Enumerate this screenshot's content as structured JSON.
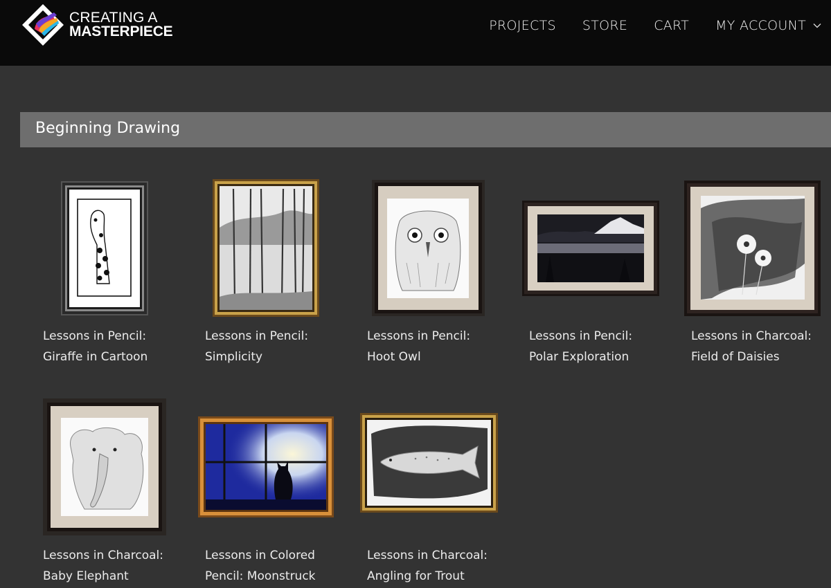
{
  "header": {
    "logo": {
      "line1": "CREATING A",
      "line2": "MASTERPIECE",
      "icon": "paint-diamond-logo-icon"
    },
    "nav": [
      {
        "label": "PROJECTS"
      },
      {
        "label": "STORE"
      },
      {
        "label": "CART"
      },
      {
        "label": "MY ACCOUNT",
        "icon": "chevron-down-icon"
      }
    ]
  },
  "section": {
    "title": "Beginning Drawing"
  },
  "projects": [
    {
      "line1": "Lessons in Pencil:",
      "line2": "Giraffe in Cartoon",
      "artwork": "giraffe-drawing"
    },
    {
      "line1": "Lessons in Pencil:",
      "line2": "Simplicity",
      "artwork": "forest-drawing"
    },
    {
      "line1": "Lessons in Pencil:",
      "line2": "Hoot Owl",
      "artwork": "owl-drawing"
    },
    {
      "line1": "Lessons in Pencil:",
      "line2": "Polar Exploration",
      "artwork": "mountain-lake-drawing"
    },
    {
      "line1": "Lessons in Charcoal:",
      "line2": "Field of Daisies",
      "artwork": "daisies-drawing"
    },
    {
      "line1": "Lessons in Charcoal:",
      "line2": "Baby Elephant",
      "artwork": "elephant-drawing"
    },
    {
      "line1": "Lessons in Colored",
      "line2": "Pencil: Moonstruck",
      "artwork": "cat-window-drawing"
    },
    {
      "line1": "Lessons in Charcoal:",
      "line2": "Angling for Trout",
      "artwork": "trout-drawing"
    }
  ],
  "colors": {
    "header_bg": "#0a0a0a",
    "page_bg": "#333333",
    "section_bar": "#6e6e6e"
  }
}
